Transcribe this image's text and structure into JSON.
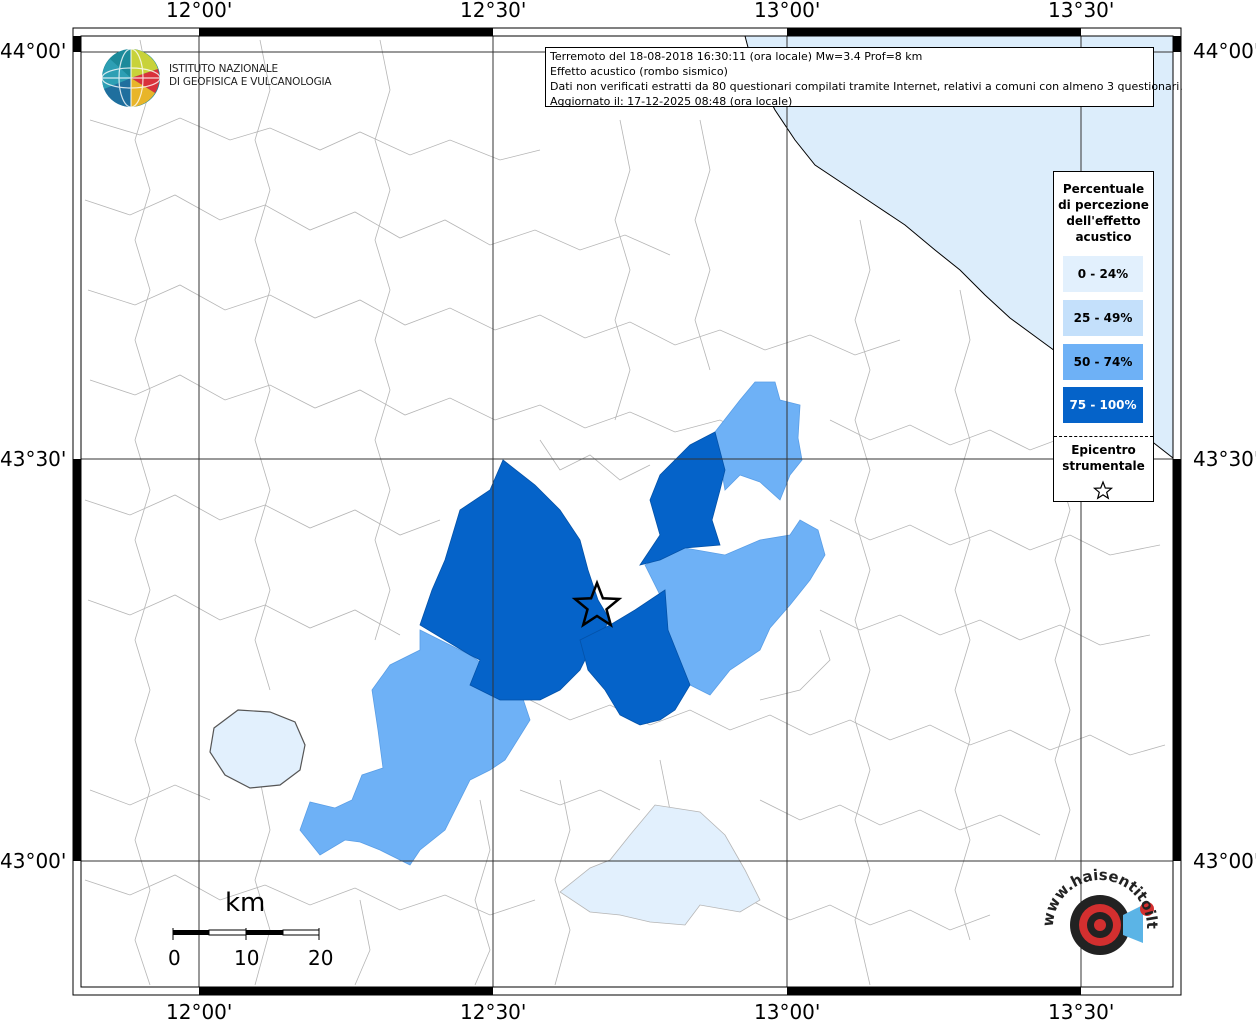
{
  "info": {
    "line1": "Terremoto del 18-08-2018 16:30:11 (ora locale) Mw=3.4 Prof=8 km",
    "line2": "Effetto acustico (rombo sismico)",
    "line3": "Dati non verificati estratti da 80 questionari compilati tramite Internet, relativi a comuni con almeno 3 questionari.",
    "line4": "Aggiornato il: 17-12-2025 08:48 (ora locale)"
  },
  "coords": {
    "lon": [
      "12°00'",
      "12°30'",
      "13°00'",
      "13°30'"
    ],
    "lat": [
      "44°00'",
      "43°30'",
      "43°00'"
    ]
  },
  "legend": {
    "title": [
      "Percentuale",
      "di percezione",
      "dell'effetto",
      "acustico"
    ],
    "classes": [
      {
        "label": "0 - 24%",
        "color": "#e2f0fd"
      },
      {
        "label": "25 - 49%",
        "color": "#c4e0fb"
      },
      {
        "label": "50 - 74%",
        "color": "#6eb1f6"
      },
      {
        "label": "75 - 100%",
        "color": "#0563c9"
      }
    ],
    "epicenter": [
      "Epicentro",
      "strumentale"
    ]
  },
  "logo": {
    "line1": "ISTITUTO NAZIONALE",
    "line2": "DI GEOFISICA E VULCANOLOGIA"
  },
  "scale": {
    "unit": "km",
    "ticks": [
      "0",
      "10",
      "20"
    ]
  },
  "brand": {
    "text": "www.haisentitoilterremoto.it"
  },
  "colors": {
    "sea": "#dcedfb",
    "lake": "#e2f0fd",
    "border": "#b5b5b5",
    "grid": "#333333"
  }
}
